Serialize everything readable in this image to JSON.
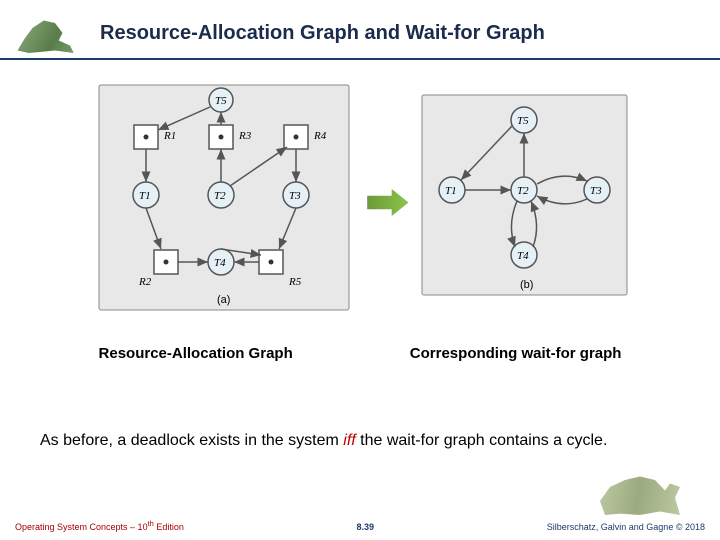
{
  "title": "Resource-Allocation Graph and  Wait-for Graph",
  "diagram_a": {
    "threads": [
      "T5",
      "T1",
      "T2",
      "T3",
      "T4"
    ],
    "resources": [
      "R1",
      "R3",
      "R4",
      "R2",
      "R5"
    ],
    "label": "(a)",
    "edges": [
      {
        "from": "R1",
        "to": "T1",
        "type": "assign"
      },
      {
        "from": "R3",
        "to": "T5",
        "type": "assign"
      },
      {
        "from": "R4",
        "to": "T3",
        "type": "assign"
      },
      {
        "from": "R2",
        "to": "T4",
        "type": "assign"
      },
      {
        "from": "R5",
        "to": "T2",
        "type": "assign"
      },
      {
        "from": "T1",
        "to": "R2",
        "type": "request"
      },
      {
        "from": "T2",
        "to": "R3",
        "type": "request"
      },
      {
        "from": "T2",
        "to": "R4",
        "type": "request"
      },
      {
        "from": "T4",
        "to": "R5",
        "type": "request"
      },
      {
        "from": "T5",
        "to": "R1",
        "type": "request"
      },
      {
        "from": "T3",
        "to": "R5",
        "type": "request"
      }
    ]
  },
  "arrow": "transforms-to",
  "diagram_b": {
    "threads": [
      "T5",
      "T1",
      "T2",
      "T3",
      "T4"
    ],
    "label": "(b)",
    "edges": [
      {
        "from": "T1",
        "to": "T2"
      },
      {
        "from": "T2",
        "to": "T3"
      },
      {
        "from": "T2",
        "to": "T4"
      },
      {
        "from": "T2",
        "to": "T5"
      },
      {
        "from": "T4",
        "to": "T2"
      },
      {
        "from": "T3",
        "to": "T2"
      },
      {
        "from": "T5",
        "to": "T1"
      }
    ]
  },
  "caption_a": "Resource-Allocation Graph",
  "caption_b": "Corresponding wait-for graph",
  "body_text_pre": "As before, a deadlock exists in the system ",
  "body_iff": "iff",
  "body_text_post": " the wait-for graph contains a cycle.",
  "footer": {
    "left_pre": "Operating System Concepts – 10",
    "left_sup": "th",
    "left_post": " Edition",
    "center": "8.39",
    "right": "Silberschatz, Galvin and Gagne © 2018"
  }
}
